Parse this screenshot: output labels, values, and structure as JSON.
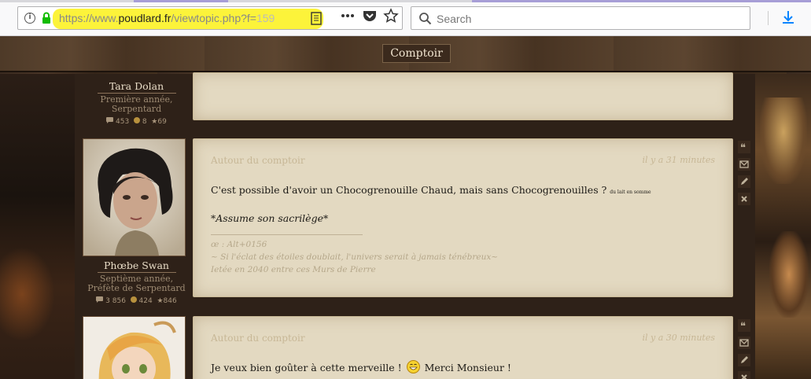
{
  "browser": {
    "url_prefix": "https://www.",
    "url_host": "poudlard.fr",
    "url_path": "/viewtopic.php?f=",
    "url_tail": "159",
    "search_placeholder": "Search",
    "highlight_color": "#fcf33a"
  },
  "forum": {
    "section_title": "Comptoir"
  },
  "posts": [
    {
      "author": "Tara Dolan",
      "rank": "Première année, Serpentard",
      "stats": {
        "messages": "453",
        "galleons": "8",
        "stars": "69"
      }
    },
    {
      "author": "Phœbe Swan",
      "rank": "Septième année, Préfète de Serpentard",
      "stats": {
        "messages": "3 856",
        "galleons": "424",
        "stars": "846"
      },
      "title": "Autour du comptoir",
      "date": "il y a 31 minutes",
      "body_main": "C'est possible d'avoir un Chocogrenouille Chaud, mais sans Chocogrenouilles ?",
      "body_small": "du lait en somme",
      "body_emphasis": "*Assume son sacrilège*",
      "signature": [
        "œ : Alt+0156",
        "~ Si l'éclat des étoiles doublait, l'univers serait à jamais ténébreux~",
        "Ietée en 2040 entre ces Murs de Pierre"
      ]
    },
    {
      "title": "Autour du comptoir",
      "date": "il y a 30 minutes",
      "body_before": "Je veux bien goûter à cette merveille !",
      "body_after": "Merci Monsieur !"
    }
  ]
}
